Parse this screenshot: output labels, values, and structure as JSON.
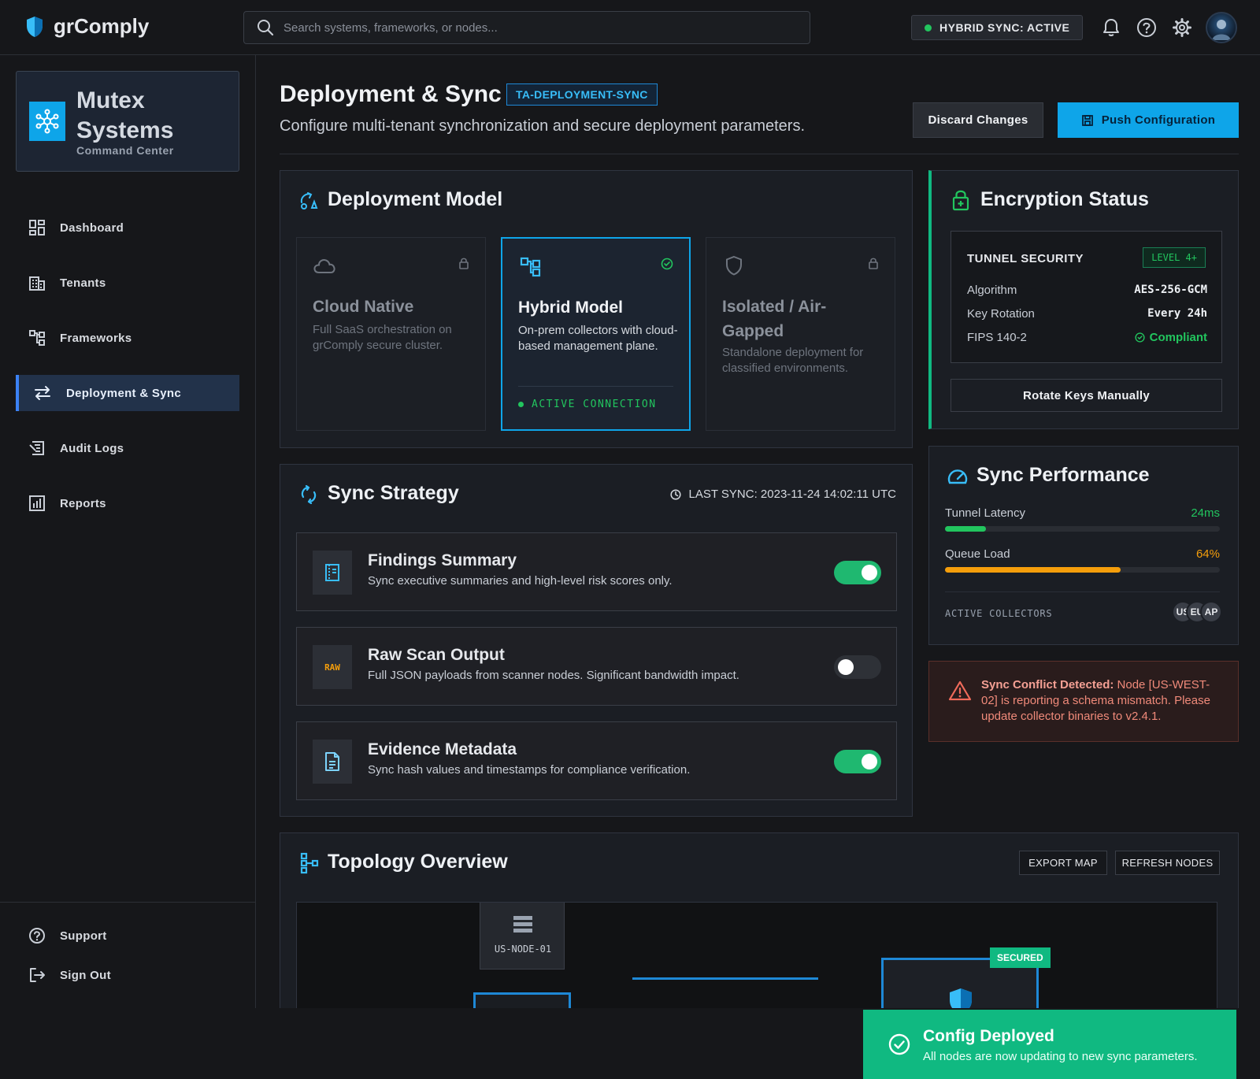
{
  "app": {
    "name": "grComply"
  },
  "search": {
    "placeholder": "Search systems, frameworks, or nodes..."
  },
  "topbar": {
    "sync_status": "HYBRID SYNC: ACTIVE"
  },
  "org": {
    "name": "Mutex Systems",
    "subtitle": "Command Center"
  },
  "nav": [
    {
      "label": "Dashboard",
      "icon": "dashboard-icon"
    },
    {
      "label": "Tenants",
      "icon": "building-icon"
    },
    {
      "label": "Frameworks",
      "icon": "framework-icon"
    },
    {
      "label": "Deployment & Sync",
      "icon": "arrows-swap-icon",
      "active": true
    },
    {
      "label": "Audit Logs",
      "icon": "audit-icon"
    },
    {
      "label": "Reports",
      "icon": "report-icon"
    }
  ],
  "nav_bottom": [
    {
      "label": "Support",
      "icon": "support-icon"
    },
    {
      "label": "Sign Out",
      "icon": "sign-out-icon"
    }
  ],
  "header": {
    "title": "Deployment & Sync",
    "tag": "TA-DEPLOYMENT-SYNC",
    "subtitle": "Configure multi-tenant synchronization and secure deployment parameters.",
    "discard_label": "Discard Changes",
    "push_label": "Push Configuration"
  },
  "deployment_model": {
    "title": "Deployment Model",
    "options": [
      {
        "title": "Cloud Native",
        "description": "Full SaaS orchestration on grComply secure cluster.",
        "locked": true
      },
      {
        "title": "Hybrid Model",
        "description": "On-prem collectors with cloud-based management plane.",
        "selected": true,
        "status": "ACTIVE CONNECTION"
      },
      {
        "title": "Isolated / Air-Gapped",
        "description": "Standalone deployment for classified environments.",
        "locked": true
      }
    ]
  },
  "sync_strategy": {
    "title": "Sync Strategy",
    "last_sync": "LAST SYNC: 2023-11-24 14:02:11 UTC",
    "items": [
      {
        "title": "Findings Summary",
        "description": "Sync executive summaries and high-level risk scores only.",
        "enabled": true,
        "icon": "summary-icon"
      },
      {
        "title": "Raw Scan Output",
        "description": "Full JSON payloads from scanner nodes. Significant bandwidth impact.",
        "enabled": false,
        "icon_text": "RAW"
      },
      {
        "title": "Evidence Metadata",
        "description": "Sync hash values and timestamps for compliance verification.",
        "enabled": true,
        "icon": "document-icon"
      }
    ]
  },
  "encryption": {
    "title": "Encryption Status",
    "box_title": "TUNNEL SECURITY",
    "level": "LEVEL 4+",
    "rows": [
      {
        "label": "Algorithm",
        "value": "AES-256-GCM"
      },
      {
        "label": "Key Rotation",
        "value": "Every 24h"
      },
      {
        "label": "FIPS 140-2",
        "value": "Compliant"
      }
    ],
    "rotate_label": "Rotate Keys Manually"
  },
  "performance": {
    "title": "Sync Performance",
    "metrics": [
      {
        "label": "Tunnel Latency",
        "value": "24ms",
        "fraction": 0.15,
        "color": "#22c55e"
      },
      {
        "label": "Queue Load",
        "value": "64%",
        "fraction": 0.64,
        "color": "#f59e0b"
      }
    ],
    "collectors_label": "ACTIVE COLLECTORS",
    "collectors": [
      "US",
      "EU",
      "AP"
    ]
  },
  "alert": {
    "strong": "Sync Conflict Detected:",
    "text": " Node [US-WEST-02] is reporting a schema mismatch. Please update collector binaries to v2.4.1."
  },
  "topology": {
    "title": "Topology Overview",
    "export_label": "EXPORT MAP",
    "refresh_label": "REFRESH NODES",
    "node_label": "US-NODE-01",
    "secured_badge": "SECURED"
  },
  "toast": {
    "title": "Config Deployed",
    "message": "All nodes are now updating to new sync parameters."
  },
  "colors": {
    "accent": "#0ea5e9",
    "success": "#22c55e",
    "warning": "#f59e0b",
    "danger": "#ef6a5a"
  }
}
